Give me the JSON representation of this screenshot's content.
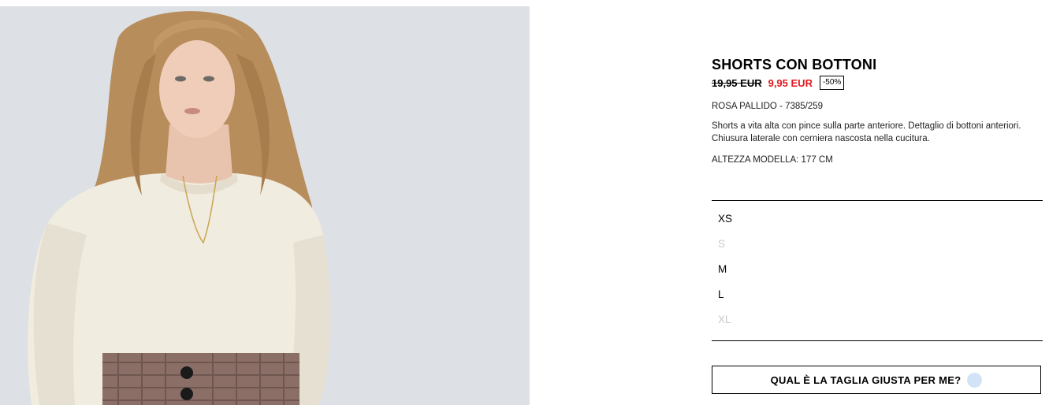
{
  "product": {
    "image_alt": "Modella con maglione bianco e shorts a quadri",
    "title": "SHORTS CON BOTTONI",
    "old_price": "19,95 EUR",
    "new_price": "9,95 EUR",
    "discount": "-50%",
    "color_ref": "ROSA PALLIDO - 7385/259",
    "description": "Shorts a vita alta con pince sulla parte anteriore. Dettaglio di bottoni anteriori. Chiusura laterale con cerniera nascosta nella cucitura.",
    "model_height": "ALTEZZA MODELLA: 177 CM"
  },
  "sizes": [
    {
      "label": "XS",
      "available": true
    },
    {
      "label": "S",
      "available": false
    },
    {
      "label": "M",
      "available": true
    },
    {
      "label": "L",
      "available": true
    },
    {
      "label": "XL",
      "available": false
    }
  ],
  "size_guide": {
    "label": "QUAL È LA TAGLIA GIUSTA PER ME?",
    "icon": "help-dot-icon"
  },
  "colors": {
    "sale_price": "#e0191f",
    "unavailable_size": "#c9c9c9",
    "help_dot": "#d3e3f7"
  }
}
